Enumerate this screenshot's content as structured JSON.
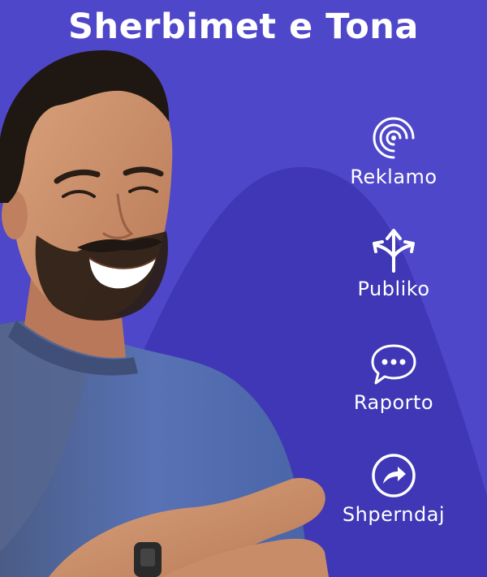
{
  "title": "Sherbimet e Tona",
  "colors": {
    "background": "#4f47c9",
    "shape": "#3f37b5",
    "text": "#ffffff"
  },
  "services": [
    {
      "label": "Reklamo",
      "icon": "signal-radar-icon"
    },
    {
      "label": "Publiko",
      "icon": "split-arrows-icon"
    },
    {
      "label": "Raporto",
      "icon": "chat-bubble-icon"
    },
    {
      "label": "Shperndaj",
      "icon": "share-arrow-icon"
    }
  ]
}
